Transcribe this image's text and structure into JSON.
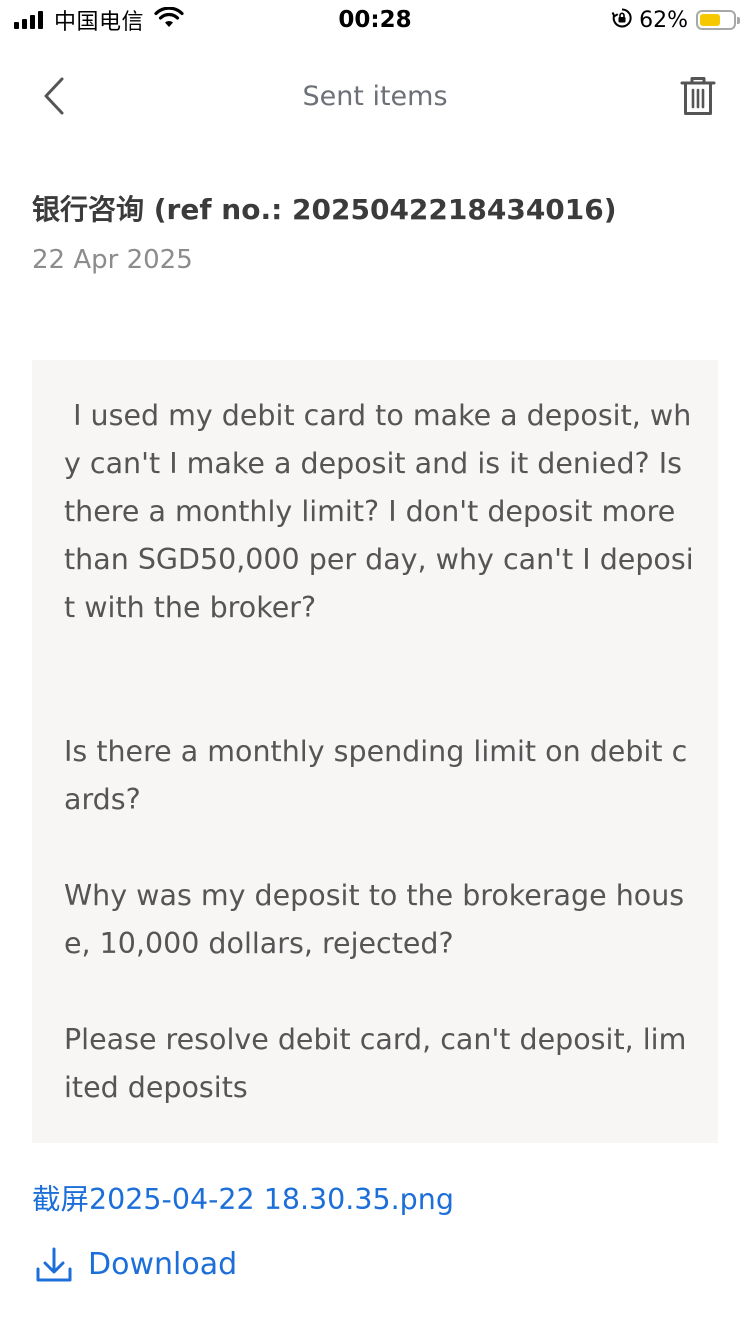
{
  "status_bar": {
    "carrier": "中国电信",
    "time": "00:28",
    "battery_percent_text": "62%",
    "battery_level": 0.62,
    "signal_bars": 4,
    "colors": {
      "battery_fill": "#f6c800"
    }
  },
  "nav": {
    "title": "Sent items",
    "back_icon": "chevron-left-icon",
    "delete_icon": "trash-icon"
  },
  "message": {
    "subject": "银行咨询 (ref no.: 2025042218434016)",
    "date": "22 Apr 2025",
    "paragraphs": [
      " I used my debit card to make a deposit, why can't I make a deposit and is it denied? Is there a monthly limit? I don't deposit more than SGD50,000 per day, why can't I deposit with the broker?",
      "Is there a monthly spending limit on debit cards?",
      "Why was my deposit to the brokerage house, 10,000 dollars, rejected?",
      "Please resolve debit card, can't deposit, limited deposits"
    ]
  },
  "attachment": {
    "filename": "截屏2025-04-22 18.30.35.png",
    "download_label": "Download",
    "download_icon": "download-icon"
  },
  "colors": {
    "link": "#1c6fd8",
    "message_background": "#f7f6f5",
    "muted_text": "#8c8c8c"
  }
}
